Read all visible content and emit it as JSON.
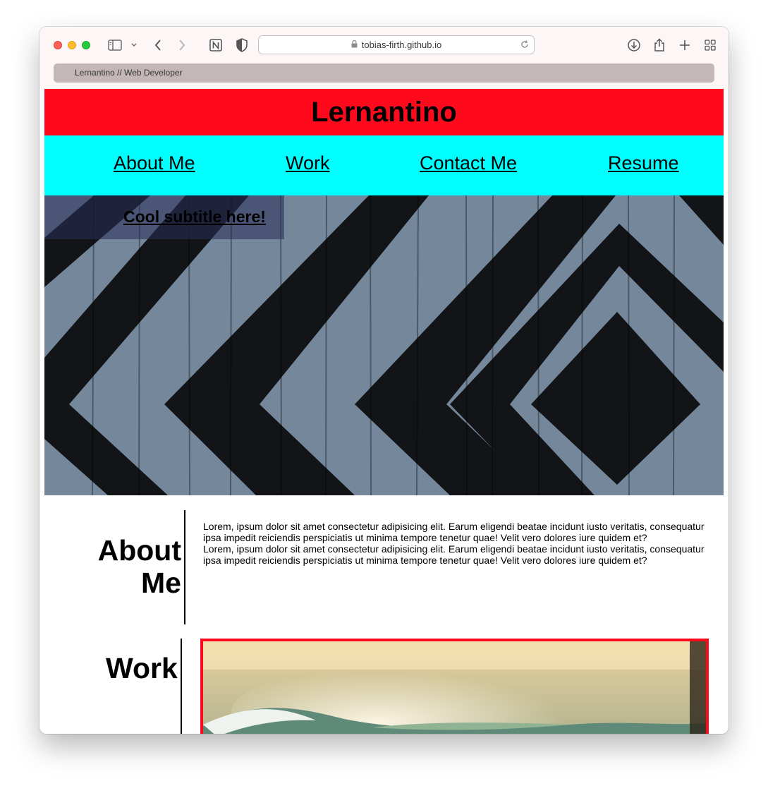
{
  "browser": {
    "url": "tobias-firth.github.io",
    "tab_title": "Lernantino // Web Developer"
  },
  "site": {
    "title": "Lernantino",
    "nav": [
      "About Me",
      "Work",
      "Contact Me",
      "Resume"
    ],
    "hero_subtitle": "Cool subtitle here!",
    "about": {
      "heading_line1": "About",
      "heading_line2": "Me",
      "paragraphs": [
        "Lorem, ipsum dolor sit amet consectetur adipisicing elit. Earum eligendi beatae incidunt iusto veritatis, consequatur ipsa impedit reiciendis perspiciatis ut minima tempore tenetur quae! Velit vero dolores iure quidem et?",
        "Lorem, ipsum dolor sit amet consectetur adipisicing elit. Earum eligendi beatae incidunt iusto veritatis, consequatur ipsa impedit reiciendis perspiciatis ut minima tempore tenetur quae! Velit vero dolores iure quidem et?"
      ]
    },
    "work": {
      "heading": "Work"
    }
  },
  "colors": {
    "header_bg": "#ff0a1d",
    "nav_bg": "#00ffff",
    "hero_light": "#75889b",
    "hero_dark": "#121417"
  },
  "icons": [
    "sidebar-icon",
    "chevron-down-icon",
    "back-icon",
    "forward-icon",
    "notion-icon",
    "shield-icon",
    "lock-icon",
    "reload-icon",
    "download-icon",
    "share-icon",
    "new-tab-icon",
    "tab-overview-icon"
  ]
}
